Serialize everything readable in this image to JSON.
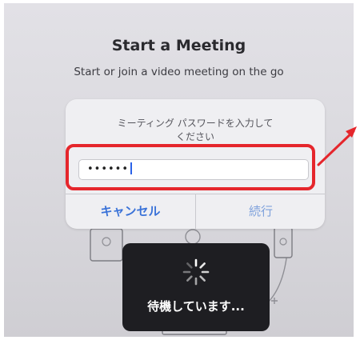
{
  "screen": {
    "title": "Start a Meeting",
    "subtitle": "Start or join a video meeting on the go"
  },
  "password_dialog": {
    "message": "ミーティング パスワードを入力して\nください",
    "password_value": "••••••",
    "cancel_label": "キャンセル",
    "continue_label": "続行"
  },
  "loading_toast": {
    "label": "待機しています..."
  },
  "colors": {
    "highlight": "#e5262c",
    "link_blue": "#3a72d8",
    "toast_bg": "#1e1e22"
  },
  "icons": {
    "spinner": "activity-spinner-icon",
    "annotation": "red-arrow-annotation"
  }
}
